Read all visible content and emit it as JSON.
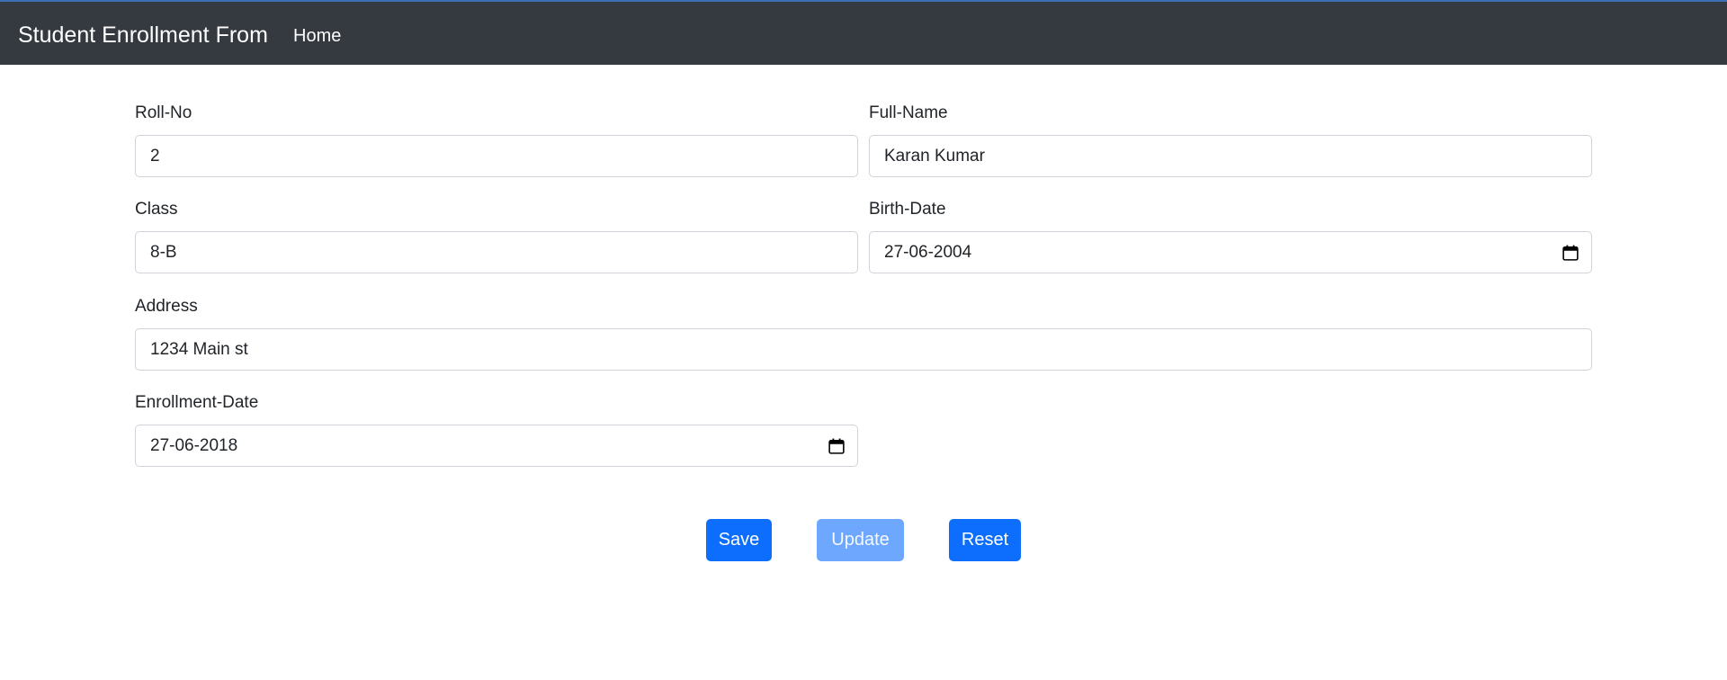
{
  "navbar": {
    "brand": "Student Enrollment From",
    "home_label": "Home"
  },
  "form": {
    "roll_no": {
      "label": "Roll-No",
      "value": "2"
    },
    "full_name": {
      "label": "Full-Name",
      "value": "Karan Kumar"
    },
    "class": {
      "label": "Class",
      "value": "8-B"
    },
    "birth_date": {
      "label": "Birth-Date",
      "value": "27-06-2004"
    },
    "address": {
      "label": "Address",
      "value": "1234 Main st"
    },
    "enrollment_date": {
      "label": "Enrollment-Date",
      "value": "27-06-2018"
    }
  },
  "buttons": {
    "save": "Save",
    "update": "Update",
    "reset": "Reset"
  },
  "colors": {
    "navbar_bg": "#343a40",
    "primary": "#0d6efd",
    "primary_disabled": "#6ea8fe"
  },
  "icons": {
    "date_picker": "calendar-icon"
  }
}
